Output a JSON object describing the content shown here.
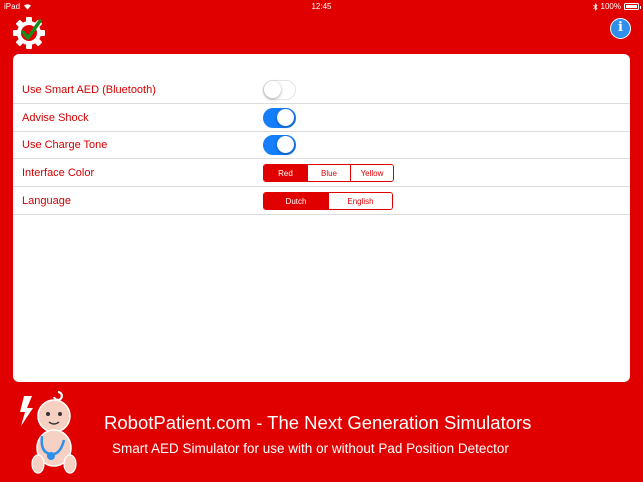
{
  "status_bar": {
    "device": "iPad",
    "time": "12:45",
    "battery_text": "100%",
    "battery_level": 1.0
  },
  "toolbar": {
    "settings_icon": "gear-check-icon",
    "info_icon": "info-icon",
    "info_glyph": "i"
  },
  "settings": {
    "rows": [
      {
        "label": "Use Smart AED (Bluetooth)",
        "type": "toggle",
        "on": false
      },
      {
        "label": "Advise Shock",
        "type": "toggle",
        "on": true
      },
      {
        "label": "Use Charge Tone",
        "type": "toggle",
        "on": true
      },
      {
        "label": "Interface Color",
        "type": "segmented",
        "options": [
          "Red",
          "Blue",
          "Yellow"
        ],
        "selected": "Red"
      },
      {
        "label": "Language",
        "type": "segmented",
        "options": [
          "Dutch",
          "English"
        ],
        "selected": "Dutch"
      }
    ]
  },
  "footer": {
    "title": "RobotPatient.com - The Next Generation Simulators",
    "subtitle": "Smart AED Simulator for use with or without Pad Position Detector",
    "mascot_icon": "baby-mascot-icon"
  },
  "colors": {
    "brand_red": "#e00000",
    "toggle_on": "#147efb",
    "info_blue": "#2f8fea"
  }
}
